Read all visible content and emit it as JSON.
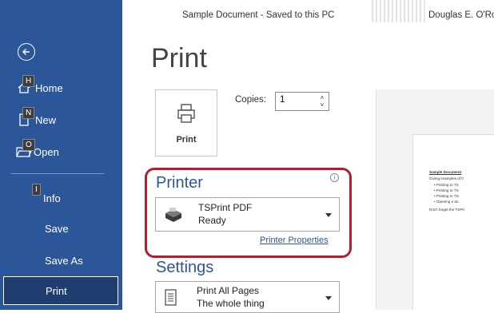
{
  "topbar": {
    "doc_title": "Sample Document  -  Saved to this PC",
    "user": "Douglas E. O'Ro"
  },
  "sidebar": {
    "home": {
      "key": "H",
      "label": "Home"
    },
    "new": {
      "key": "N",
      "label": "New"
    },
    "open": {
      "key": "O",
      "label": "Open"
    },
    "info": {
      "key": "I",
      "label": "Info"
    },
    "save": "Save",
    "save_as": "Save As",
    "print": "Print"
  },
  "page_title": "Print",
  "print_button": "Print",
  "copies": {
    "label": "Copies:",
    "value": "1"
  },
  "printer": {
    "section": "Printer",
    "name": "TSPrint PDF",
    "status": "Ready",
    "properties_link": "Printer Properties"
  },
  "settings": {
    "section": "Settings",
    "option": "Print All Pages",
    "option_sub": "The whole thing"
  },
  "preview": {
    "title": "Sample Document",
    "intro": "Giving examples of h",
    "bullets": [
      "Printing to TS",
      "Printing to TS",
      "Printing to TS",
      "Opening a do"
    ],
    "closing": "Don't forget the TSPri"
  }
}
